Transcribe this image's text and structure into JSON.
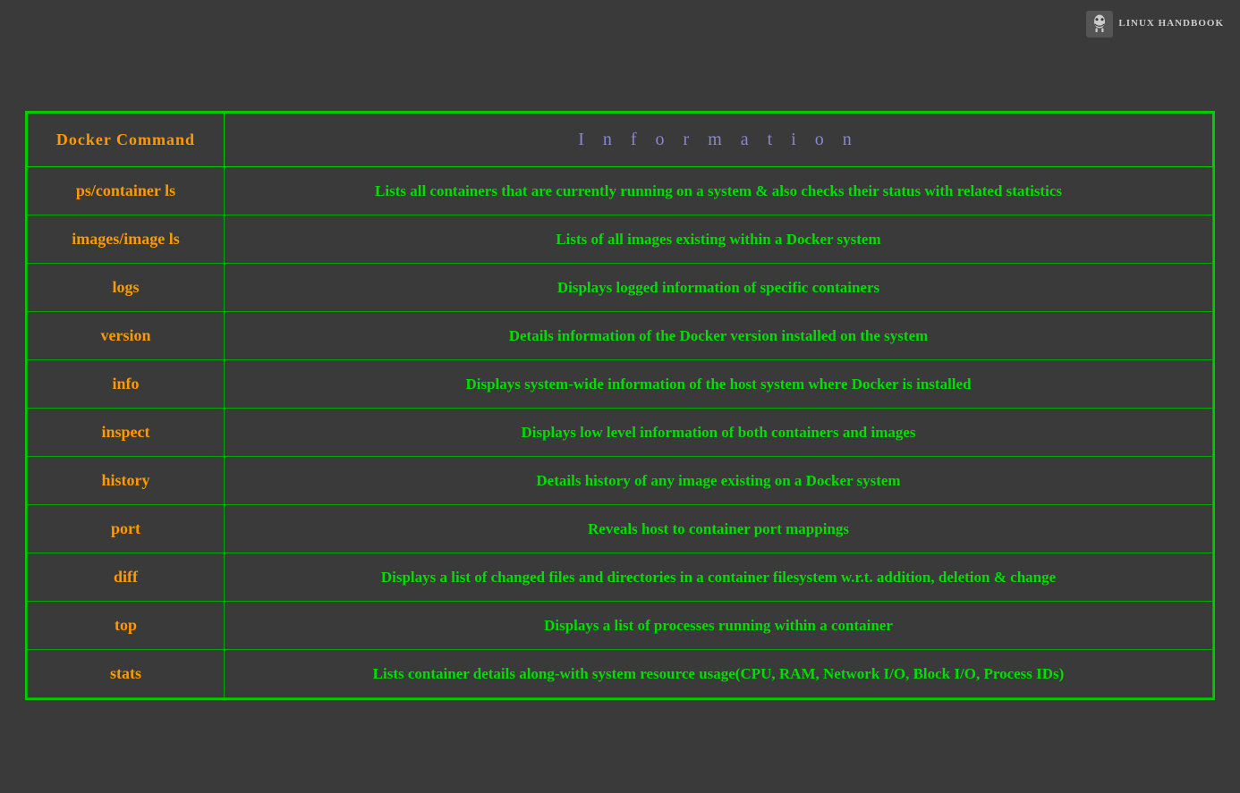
{
  "logo": {
    "text": "LINUX\nHANDBOOK"
  },
  "table": {
    "header": {
      "cmd_label": "Docker Command",
      "info_label": "I n f o r m a t i o n"
    },
    "rows": [
      {
        "command": "ps/container ls",
        "info": "Lists all containers that are currently running on a system & also checks their status with related statistics"
      },
      {
        "command": "images/image ls",
        "info": "Lists of all images existing within a Docker system"
      },
      {
        "command": "logs",
        "info": "Displays logged information of specific containers"
      },
      {
        "command": "version",
        "info": "Details information of the Docker version installed on the system"
      },
      {
        "command": "info",
        "info": "Displays system-wide information of the host system where Docker is installed"
      },
      {
        "command": "inspect",
        "info": "Displays low level information  of both containers and images"
      },
      {
        "command": "history",
        "info": "Details history of any image existing on a Docker system"
      },
      {
        "command": "port",
        "info": "Reveals host to container port mappings"
      },
      {
        "command": "diff",
        "info": "Displays a list of changed files and directories in a container filesystem w.r.t. addition, deletion & change"
      },
      {
        "command": "top",
        "info": "Displays a list of processes running within a container"
      },
      {
        "command": "stats",
        "info": "Lists container details along-with system resource usage(CPU, RAM, Network I/O, Block I/O, Process IDs)"
      }
    ]
  }
}
